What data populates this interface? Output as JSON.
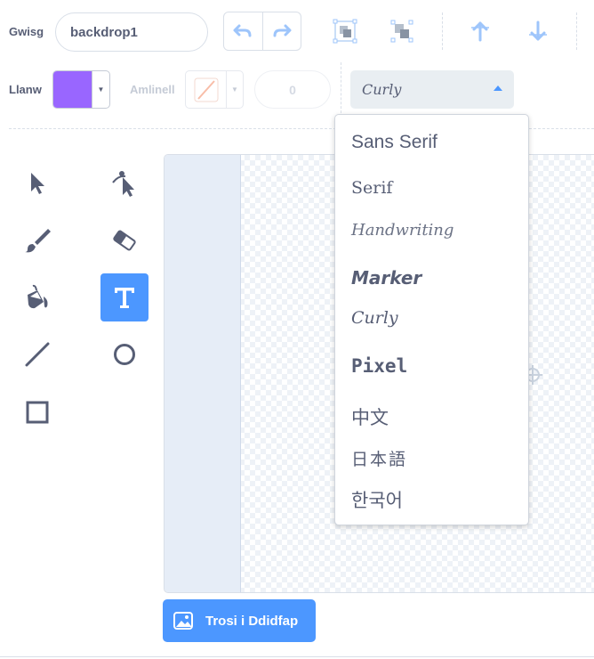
{
  "toolbar": {
    "costume_label": "Gwisg",
    "costume_name": "backdrop1",
    "fill_label": "Llanw",
    "outline_label": "Amlinell",
    "outline_width": "0",
    "fill_color": "#9966ff",
    "selected_font": "Curly"
  },
  "font_menu": {
    "items": [
      "Sans Serif",
      "Serif",
      "Handwriting",
      "Marker",
      "Curly",
      "Pixel",
      "中文",
      "日本語",
      "한국어"
    ]
  },
  "convert_button": {
    "label": "Trosi i Ddidfap"
  },
  "colors": {
    "accent": "#4c97ff",
    "text": "#575e75",
    "fill": "#9966ff"
  }
}
